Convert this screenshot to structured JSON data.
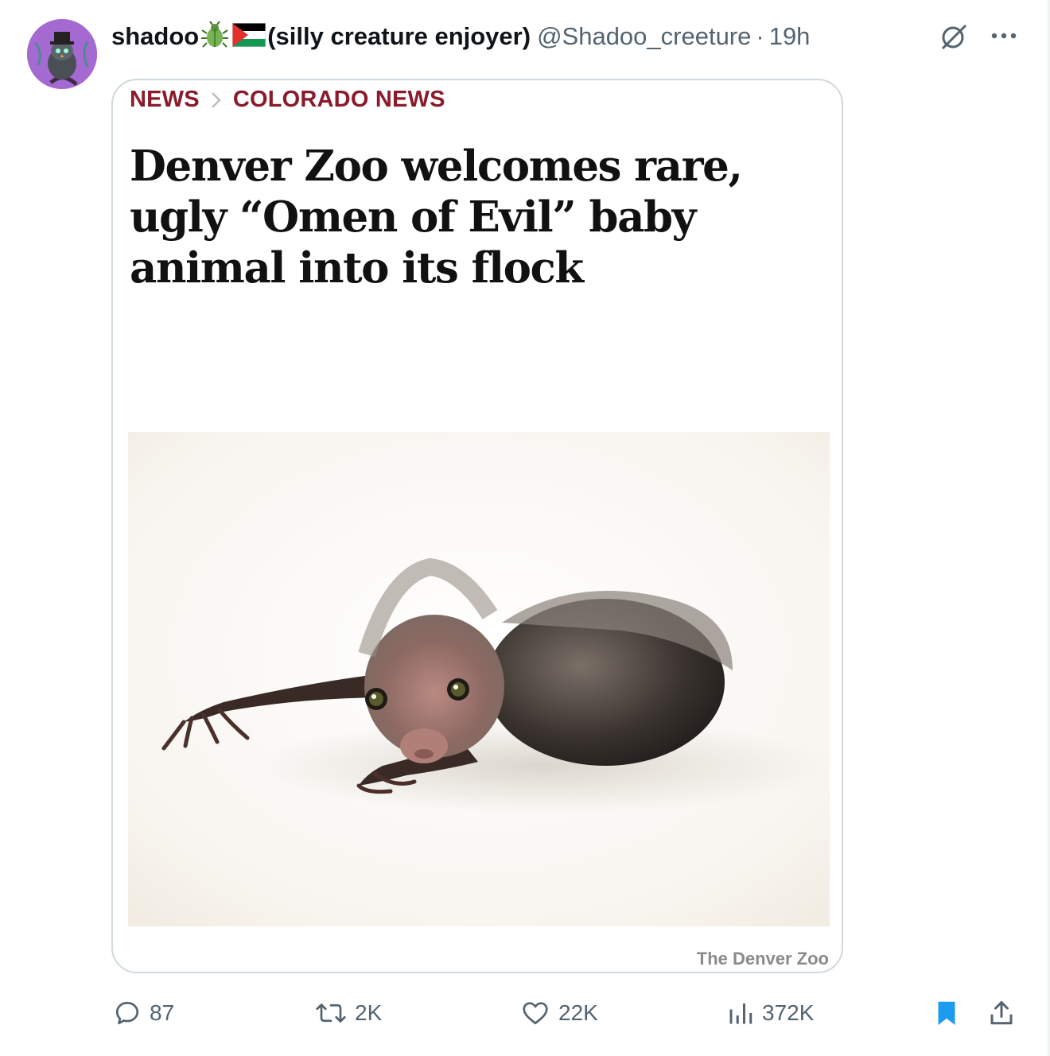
{
  "tweet": {
    "display_name": "shadoo",
    "display_name_suffix": "(silly creature enjoyer)",
    "handle": "@Shadoo_creeture",
    "separator": "·",
    "time": "19h"
  },
  "icons": {
    "avatar": "owl-avatar",
    "emoji_1": "beetle-emoji",
    "emoji_2": "palestine-flag-emoji",
    "grok": "grok-icon",
    "more": "more-icon"
  },
  "article": {
    "breadcrumb": [
      "NEWS",
      "COLORADO NEWS"
    ],
    "headline_lines": [
      "Denver Zoo welcomes rare,",
      "ugly “Omen of Evil” baby",
      "animal into its flock"
    ],
    "photo_credit": "The Denver Zoo"
  },
  "actions": {
    "replies": "87",
    "reposts": "2K",
    "likes": "22K",
    "views": "372K"
  },
  "colors": {
    "breadcrumb": "#8b1a2b",
    "secondary_text": "#536471",
    "bookmark": "#1d9bf0",
    "card_border": "#cfd9de"
  }
}
